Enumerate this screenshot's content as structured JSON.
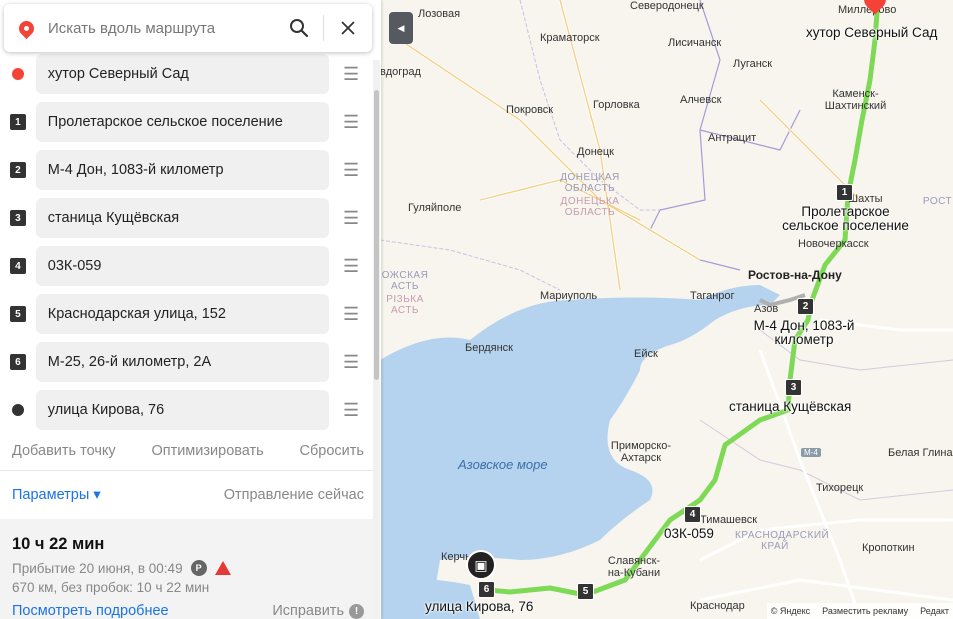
{
  "search": {
    "placeholder": "Искать вдоль маршрута"
  },
  "waypoints": [
    {
      "marker": "start",
      "label": "хутор Северный Сад"
    },
    {
      "marker": "1",
      "label": "Пролетарское сельское поселение"
    },
    {
      "marker": "2",
      "label": "М-4 Дон, 1083-й километр"
    },
    {
      "marker": "3",
      "label": "станица Кущёвская"
    },
    {
      "marker": "4",
      "label": "03К-059"
    },
    {
      "marker": "5",
      "label": "Краснодарская улица, 152"
    },
    {
      "marker": "6",
      "label": "М-25, 26-й километр, 2А"
    },
    {
      "marker": "end",
      "label": "улица Кирова, 76"
    }
  ],
  "actions": {
    "add": "Добавить точку",
    "optimize": "Оптимизировать",
    "reset": "Сбросить"
  },
  "params": {
    "label": "Параметры ▾",
    "departure": "Отправление сейчас"
  },
  "summary": {
    "duration": "10 ч 22 мин",
    "arrival": "Прибытие 20 июня, в 00:49",
    "distance": "670 км, без пробок: 10 ч 22 мин",
    "details": "Посмотреть подробнее",
    "fix": "Исправить",
    "parking_badge": "P"
  },
  "colors": {
    "route": "#7ed957",
    "start": "#f44336",
    "accent": "#1a73e8"
  },
  "map": {
    "cities": [
      "Лозовая",
      "Северодонецк",
      "Миллерово",
      "Краматорск",
      "Лисичанск",
      "Луганск",
      "вдоград",
      "Покровск",
      "Горловка",
      "Алчевск",
      "Каменск-Шахтинский",
      "Антрацит",
      "Донецк",
      "Гуляйполе",
      "Шахты",
      "Новочеркасск",
      "Ростов-на-Дону",
      "Таганрог",
      "Мариуполь",
      "Азов",
      "Бердянск",
      "Ейск",
      "Приморско-Ахтарск",
      "Белая Глина",
      "Тихорецк",
      "Тимашевск",
      "Славянск-на-Кубани",
      "Керчь",
      "Кропоткин",
      "Краснодар"
    ],
    "regions": {
      "donetsk": "ДОНЕЦКАЯ ОБЛАСТЬ",
      "donetsk_ua": "ДОНЕЦЬКА ОБЛАСТЬ",
      "zap": "ОЖСКАЯ АСТЬ",
      "zap_ua": "РІЗЬКА АСТЬ",
      "rostov": "РОСТ",
      "krasnodar": "КРАСНОДАРСКИЙ КРАЙ"
    },
    "sea": "Азовское море",
    "road_badge": "M-4",
    "labels": {
      "start": "хутор Северный Сад",
      "w1": "Пролетарское сельское поселение",
      "w2": "М-4 Дон, 1083-й километр",
      "w3": "станица Кущёвская",
      "w4": "03К-059",
      "end": "улица Кирова, 76"
    },
    "markers": [
      "1",
      "2",
      "3",
      "4",
      "5",
      "6"
    ],
    "footer": {
      "copyright": "© Яндекс",
      "ads": "Разместить рекламу",
      "edit": "Редакт"
    }
  }
}
